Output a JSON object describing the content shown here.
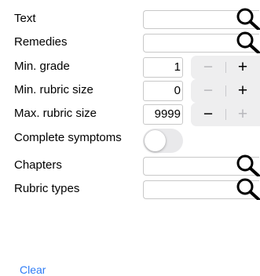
{
  "form": {
    "text_label": "Text",
    "remedies_label": "Remedies",
    "min_grade_label": "Min. grade",
    "min_grade_value": "1",
    "min_rubric_label": "Min. rubric size",
    "min_rubric_value": "0",
    "max_rubric_label": "Max. rubric size",
    "max_rubric_value": "9999",
    "complete_symptoms_label": "Complete symptoms",
    "complete_symptoms_on": false,
    "chapters_label": "Chapters",
    "rubric_types_label": "Rubric types"
  },
  "stepper": {
    "minus": "−",
    "plus": "+"
  },
  "icons": {
    "search": "magnifier-icon"
  },
  "colors": {
    "accent": "#2e7cf6",
    "disabled": "#b8b8bc"
  },
  "footer": {
    "clear_label": "Clear"
  }
}
